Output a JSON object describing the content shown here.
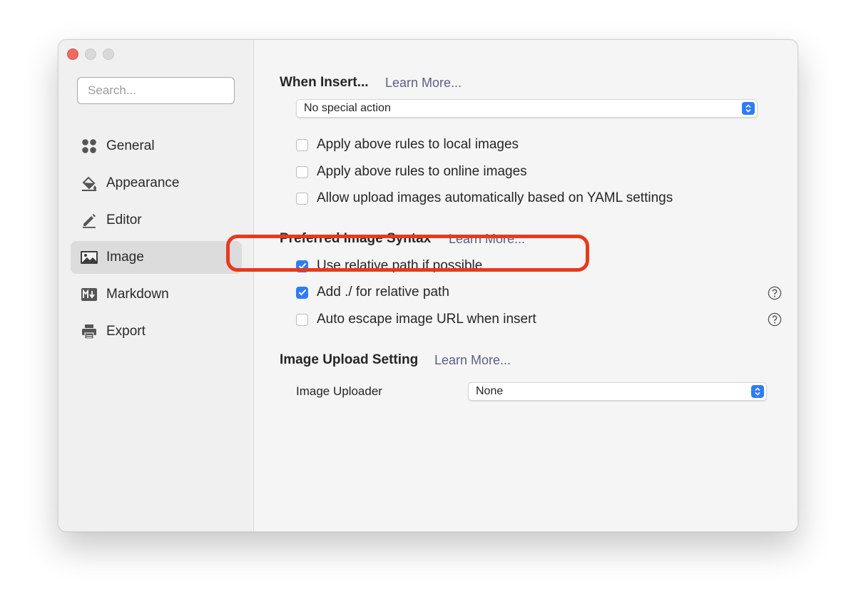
{
  "search": {
    "placeholder": "Search..."
  },
  "sidebar": {
    "items": [
      {
        "label": "General",
        "icon": "general-icon",
        "active": false
      },
      {
        "label": "Appearance",
        "icon": "paint-bucket-icon",
        "active": false
      },
      {
        "label": "Editor",
        "icon": "pencil-icon",
        "active": false
      },
      {
        "label": "Image",
        "icon": "image-icon",
        "active": true
      },
      {
        "label": "Markdown",
        "icon": "markdown-icon",
        "active": false
      },
      {
        "label": "Export",
        "icon": "printer-icon",
        "active": false
      }
    ]
  },
  "when_insert": {
    "title": "When Insert...",
    "learn_more": "Learn More...",
    "select_value": "No special action",
    "options": [
      {
        "label": "Apply above rules to local images",
        "checked": false
      },
      {
        "label": "Apply above rules to online images",
        "checked": false
      },
      {
        "label": "Allow upload images automatically based on YAML settings",
        "checked": false
      }
    ]
  },
  "syntax": {
    "title": "Preferred Image Syntax",
    "learn_more": "Learn More...",
    "options": [
      {
        "label": "Use relative path if possible",
        "checked": true
      },
      {
        "label": "Add ./ for relative path",
        "checked": true
      },
      {
        "label": "Auto escape image URL when insert",
        "checked": false
      }
    ]
  },
  "upload": {
    "title": "Image Upload Setting",
    "learn_more": "Learn More...",
    "uploader_label": "Image Uploader",
    "uploader_value": "None"
  },
  "colors": {
    "accent": "#2f7cf6",
    "highlight": "#e8391d",
    "link": "#5a5f86"
  }
}
